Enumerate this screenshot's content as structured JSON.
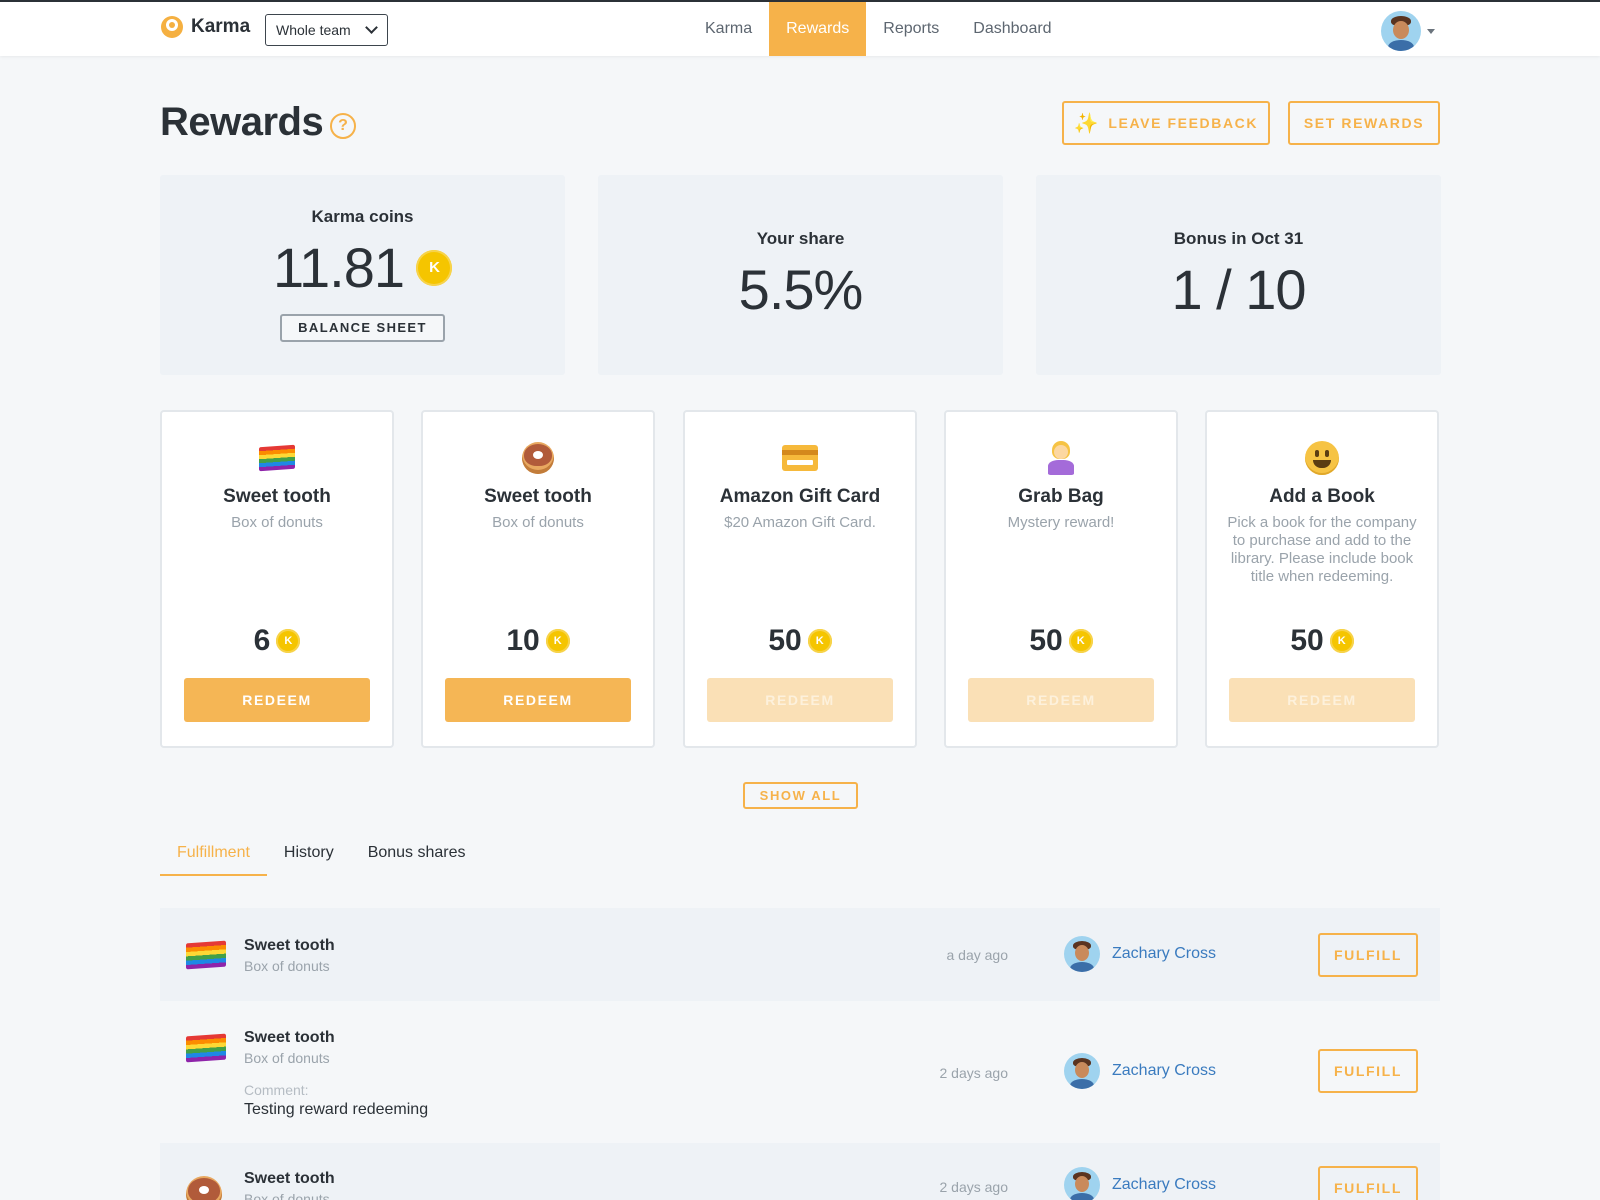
{
  "app": {
    "brand": "Karma",
    "team_selector": "Whole team",
    "nav": [
      "Karma",
      "Rewards",
      "Reports",
      "Dashboard"
    ],
    "active_nav": "Rewards"
  },
  "header": {
    "title": "Rewards",
    "help": "?",
    "leave_feedback": "LEAVE FEEDBACK",
    "set_rewards": "SET REWARDS"
  },
  "stats": {
    "coins_label": "Karma coins",
    "coins_value": "11.81",
    "coin_symbol": "K",
    "balance_sheet": "BALANCE SHEET",
    "share_label": "Your share",
    "share_value": "5.5%",
    "bonus_label": "Bonus in Oct 31",
    "bonus_value": "1 / 10"
  },
  "rewards": [
    {
      "icon": "rainbow-flag-icon",
      "title": "Sweet tooth",
      "description": "Box of donuts",
      "price": "6",
      "button": "REDEEM",
      "enabled": true
    },
    {
      "icon": "donut-icon",
      "title": "Sweet tooth",
      "description": "Box of donuts",
      "price": "10",
      "button": "REDEEM",
      "enabled": true
    },
    {
      "icon": "credit-card-icon",
      "title": "Amazon Gift Card",
      "description": "$20 Amazon Gift Card.",
      "price": "50",
      "button": "REDEEM",
      "enabled": false
    },
    {
      "icon": "person-shrugging-icon",
      "title": "Grab Bag",
      "description": "Mystery reward!",
      "price": "50",
      "button": "REDEEM",
      "enabled": false
    },
    {
      "icon": "smiley-icon",
      "title": "Add a Book",
      "description": "Pick a book for the company to purchase and add to the library. Please include book title when redeeming.",
      "price": "50",
      "button": "REDEEM",
      "enabled": false
    }
  ],
  "show_all": "SHOW ALL",
  "tabs": [
    "Fulfillment",
    "History",
    "Bonus shares"
  ],
  "active_tab": "Fulfillment",
  "fulfillment": [
    {
      "icon": "rainbow-flag-icon",
      "title": "Sweet tooth",
      "subtitle": "Box of donuts",
      "time": "a day ago",
      "user": "Zachary Cross",
      "button": "FULFILL"
    },
    {
      "icon": "rainbow-flag-icon",
      "title": "Sweet tooth",
      "subtitle": "Box of donuts",
      "comment_label": "Comment:",
      "comment": "Testing reward redeeming",
      "time": "2 days ago",
      "user": "Zachary Cross",
      "button": "FULFILL"
    },
    {
      "icon": "donut-icon",
      "title": "Sweet tooth",
      "subtitle": "Box of donuts",
      "time": "2 days ago",
      "user": "Zachary Cross",
      "button": "FULFILL"
    }
  ],
  "colors": {
    "accent": "#f6b24a",
    "coin": "#f5c500",
    "link": "#3a7bbf",
    "text": "#2b3137",
    "muted": "#9aa3ab",
    "card_bg": "#eef2f6"
  }
}
